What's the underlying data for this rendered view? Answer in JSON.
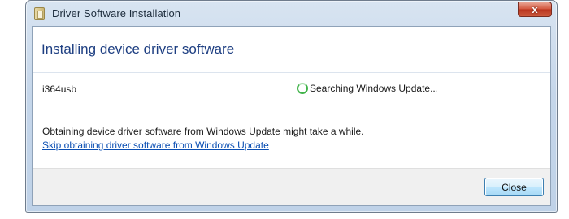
{
  "window": {
    "title": "Driver Software Installation",
    "close_glyph": "x"
  },
  "main": {
    "heading": "Installing device driver software",
    "device_name": "i364usb",
    "status": "Searching Windows Update...",
    "info_text": "Obtaining device driver software from Windows Update might take a while.",
    "skip_link": "Skip obtaining driver software from Windows Update"
  },
  "footer": {
    "close_label": "Close"
  },
  "icons": {
    "app": "driver-installation-icon",
    "status": "searching-spinner-icon"
  },
  "colors": {
    "heading": "#1e3f82",
    "link": "#0b4fb3",
    "spinner": "#41b34a",
    "close_x": "#d2543b"
  }
}
